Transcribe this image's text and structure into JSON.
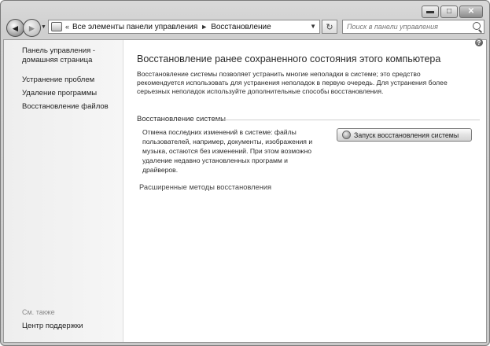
{
  "window": {
    "caption_buttons": [
      {
        "name": "minimize",
        "glyph": "▬"
      },
      {
        "name": "maximize",
        "glyph": "□"
      },
      {
        "name": "close",
        "glyph": "✕"
      }
    ]
  },
  "nav": {
    "back_glyph": "◄",
    "forward_glyph": "►",
    "history_dropdown_glyph": "▼",
    "address_icon": "control-panel-icon",
    "breadcrumb_sep_first": "«",
    "breadcrumb": [
      {
        "label": "Все элементы панели управления"
      },
      {
        "label": "Восстановление"
      }
    ],
    "breadcrumb_sep": "►",
    "address_dropdown_glyph": "▼",
    "refresh_glyph": "↻",
    "search_placeholder": "Поиск в панели управления"
  },
  "sidebar": {
    "home_line1": "Панель управления -",
    "home_line2": "домашняя страница",
    "links": [
      {
        "label": "Устранение проблем"
      },
      {
        "label": "Удаление программы"
      },
      {
        "label": "Восстановление файлов"
      }
    ],
    "see_also": "См. также",
    "support": "Центр поддержки"
  },
  "main": {
    "help_glyph": "?",
    "title": "Восстановление ранее сохраненного состояния этого компьютера",
    "description": "Восстановление системы позволяет устранить многие неполадки в системе; это средство рекомендуется использовать для устранения неполадок в первую очередь. Для устранения более серьезных неполадок используйте дополнительные способы восстановления.",
    "section_title": "Восстановление системы",
    "section_text": "Отмена последних изменений в системе: файлы пользователей, например, документы, изображения и музыка, остаются без изменений. При этом возможно удаление недавно установленных программ и драйверов.",
    "restore_button": "Запуск восстановления системы",
    "advanced_link": "Расширенные методы восстановления"
  }
}
